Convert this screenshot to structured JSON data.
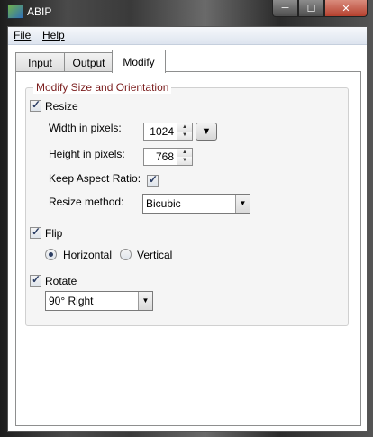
{
  "window": {
    "title": "ABIP"
  },
  "menu": [
    {
      "label": "File"
    },
    {
      "label": "Help"
    }
  ],
  "tabs": [
    {
      "label": "Input"
    },
    {
      "label": "Output"
    },
    {
      "label": "Modify"
    }
  ],
  "modify": {
    "group_title": "Modify Size and Orientation",
    "resize": {
      "label": "Resize",
      "checked": true,
      "width_label": "Width in pixels:",
      "width_value": "1024",
      "height_label": "Height in pixels:",
      "height_value": "768",
      "keep_aspect_label": "Keep Aspect Ratio:",
      "keep_aspect_checked": true,
      "method_label": "Resize method:",
      "method_value": "Bicubic"
    },
    "flip": {
      "label": "Flip",
      "checked": true,
      "horizontal_label": "Horizontal",
      "vertical_label": "Vertical",
      "selected": "Horizontal"
    },
    "rotate": {
      "label": "Rotate",
      "checked": true,
      "value": "90° Right"
    }
  },
  "icons": {
    "app": "abip-app-icon",
    "minimize": "minimize-icon",
    "maximize": "maximize-icon",
    "close": "close-icon",
    "checkbox": "checkmark-icon",
    "dropdown": "chevron-down-icon"
  }
}
